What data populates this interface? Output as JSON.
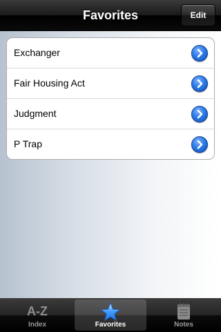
{
  "navbar": {
    "title": "Favorites",
    "edit_label": "Edit"
  },
  "favorites": [
    {
      "label": "Exchanger"
    },
    {
      "label": "Fair Housing Act"
    },
    {
      "label": "Judgment"
    },
    {
      "label": "P Trap"
    }
  ],
  "tabbar": {
    "tabs": [
      {
        "label": "Index",
        "icon": "A-Z",
        "selected": false
      },
      {
        "label": "Favorites",
        "icon": "star-icon",
        "selected": true
      },
      {
        "label": "Notes",
        "icon": "notepad-icon",
        "selected": false
      }
    ]
  },
  "colors": {
    "accent_blue": "#2d7be8",
    "navbar_black": "#000000"
  }
}
